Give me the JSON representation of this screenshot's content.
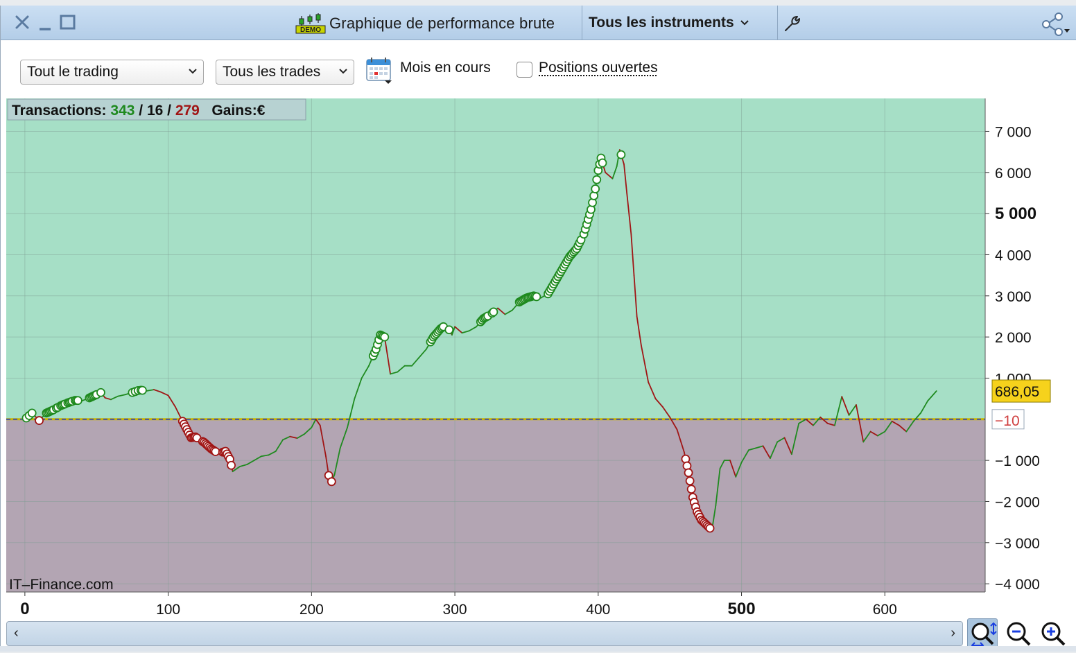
{
  "window": {
    "title": "Graphique de performance brute",
    "demo_badge": "DEMO",
    "instrument_selector": "Tous les instruments",
    "icons": [
      "close-icon",
      "minimize-icon",
      "maximize-icon",
      "demo-chart-icon",
      "wrench-icon",
      "share-icon"
    ]
  },
  "toolbar": {
    "trading_filter": "Tout le trading",
    "trades_filter": "Tous les trades",
    "period_label": "Mois en cours",
    "open_positions_label": "Positions ouvertes",
    "open_positions_checked": false
  },
  "stats": {
    "transactions_label": "Transactions:",
    "total": "343",
    "separator": "/",
    "neutral": "16",
    "losses": "279",
    "gains_label": "Gains:",
    "currency": "€"
  },
  "watermark": "IT–Finance.com",
  "colors": {
    "positive_zone": "#a6dfc6",
    "negative_zone": "#b3a5b3",
    "gain_line": "#1f8a1f",
    "loss_line": "#a01515",
    "current_badge": "#f6d21c",
    "title_bar": "#c1d6ec"
  },
  "chart_data": {
    "type": "line",
    "title": "",
    "xlabel": "",
    "ylabel": "",
    "x_ticks": [
      "0",
      "100",
      "200",
      "300",
      "400",
      "500",
      "600"
    ],
    "y_ticks": [
      "7 000",
      "6 000",
      "5 000",
      "4 000",
      "3 000",
      "2 000",
      "1 000",
      "−1 000",
      "−2 000",
      "−3 000",
      "−4 000"
    ],
    "xlim": [
      -13,
      670
    ],
    "ylim": [
      -4200,
      7800
    ],
    "baseline": 0,
    "current_value_label": "686,05",
    "reference_value_label": "−10",
    "grid": true,
    "series": [
      {
        "points": [
          [
            0,
            0
          ],
          [
            5,
            150
          ],
          [
            10,
            -30
          ],
          [
            15,
            150
          ],
          [
            20,
            230
          ],
          [
            25,
            330
          ],
          [
            30,
            400
          ],
          [
            35,
            460
          ],
          [
            40,
            450
          ],
          [
            45,
            520
          ],
          [
            50,
            600
          ],
          [
            53,
            650
          ],
          [
            56,
            520
          ],
          [
            60,
            480
          ],
          [
            65,
            560
          ],
          [
            70,
            600
          ],
          [
            75,
            650
          ],
          [
            80,
            710
          ],
          [
            85,
            690
          ],
          [
            90,
            720
          ],
          [
            95,
            660
          ],
          [
            100,
            580
          ],
          [
            105,
            300
          ],
          [
            110,
            -50
          ],
          [
            113,
            -250
          ],
          [
            116,
            -450
          ],
          [
            119,
            -430
          ],
          [
            122,
            -500
          ],
          [
            125,
            -560
          ],
          [
            130,
            -720
          ],
          [
            135,
            -830
          ],
          [
            140,
            -780
          ],
          [
            143,
            -970
          ],
          [
            145,
            -1270
          ],
          [
            150,
            -1150
          ],
          [
            155,
            -1100
          ],
          [
            160,
            -1000
          ],
          [
            165,
            -900
          ],
          [
            170,
            -870
          ],
          [
            175,
            -780
          ],
          [
            180,
            -500
          ],
          [
            185,
            -420
          ],
          [
            190,
            -460
          ],
          [
            195,
            -360
          ],
          [
            200,
            -200
          ],
          [
            203,
            0
          ],
          [
            206,
            -150
          ],
          [
            210,
            -900
          ],
          [
            213,
            -1600
          ],
          [
            216,
            -1350
          ],
          [
            220,
            -700
          ],
          [
            225,
            -200
          ],
          [
            230,
            500
          ],
          [
            235,
            1000
          ],
          [
            240,
            1300
          ],
          [
            245,
            1700
          ],
          [
            248,
            2050
          ],
          [
            251,
            2000
          ],
          [
            255,
            1100
          ],
          [
            260,
            1150
          ],
          [
            265,
            1300
          ],
          [
            270,
            1300
          ],
          [
            275,
            1500
          ],
          [
            280,
            1700
          ],
          [
            285,
            2000
          ],
          [
            290,
            2200
          ],
          [
            294,
            2300
          ],
          [
            298,
            2050
          ],
          [
            300,
            2250
          ],
          [
            305,
            2100
          ],
          [
            310,
            2150
          ],
          [
            315,
            2250
          ],
          [
            320,
            2450
          ],
          [
            325,
            2550
          ],
          [
            330,
            2700
          ],
          [
            335,
            2550
          ],
          [
            340,
            2650
          ],
          [
            345,
            2850
          ],
          [
            350,
            2950
          ],
          [
            355,
            3000
          ],
          [
            360,
            2950
          ],
          [
            365,
            3050
          ],
          [
            370,
            3350
          ],
          [
            375,
            3650
          ],
          [
            380,
            3950
          ],
          [
            385,
            4150
          ],
          [
            390,
            4500
          ],
          [
            395,
            5100
          ],
          [
            398,
            5600
          ],
          [
            400,
            6050
          ],
          [
            402,
            6350
          ],
          [
            405,
            6000
          ],
          [
            410,
            5850
          ],
          [
            413,
            6150
          ],
          [
            415,
            6550
          ],
          [
            418,
            6200
          ],
          [
            420,
            5500
          ],
          [
            423,
            4500
          ],
          [
            425,
            3500
          ],
          [
            427,
            2500
          ],
          [
            430,
            1800
          ],
          [
            435,
            900
          ],
          [
            440,
            500
          ],
          [
            445,
            300
          ],
          [
            450,
            50
          ],
          [
            455,
            -250
          ],
          [
            460,
            -800
          ],
          [
            463,
            -1300
          ],
          [
            466,
            -1900
          ],
          [
            469,
            -2250
          ],
          [
            472,
            -2450
          ],
          [
            475,
            -2550
          ],
          [
            478,
            -2650
          ],
          [
            480,
            -2550
          ],
          [
            482,
            -2100
          ],
          [
            485,
            -1200
          ],
          [
            488,
            -1000
          ],
          [
            492,
            -1000
          ],
          [
            496,
            -1400
          ],
          [
            500,
            -1050
          ],
          [
            505,
            -750
          ],
          [
            510,
            -700
          ],
          [
            515,
            -650
          ],
          [
            520,
            -950
          ],
          [
            525,
            -550
          ],
          [
            530,
            -450
          ],
          [
            535,
            -850
          ],
          [
            540,
            -100
          ],
          [
            545,
            0
          ],
          [
            550,
            -150
          ],
          [
            555,
            50
          ],
          [
            560,
            -100
          ],
          [
            565,
            -150
          ],
          [
            570,
            550
          ],
          [
            575,
            100
          ],
          [
            580,
            350
          ],
          [
            585,
            -550
          ],
          [
            590,
            -300
          ],
          [
            595,
            -400
          ],
          [
            600,
            -300
          ],
          [
            605,
            -50
          ],
          [
            610,
            -150
          ],
          [
            615,
            -300
          ],
          [
            620,
            -50
          ],
          [
            625,
            150
          ],
          [
            630,
            450
          ],
          [
            636,
            686
          ]
        ],
        "gain_markers_x": [
          1,
          3,
          5,
          15,
          16,
          17,
          18,
          19,
          20,
          22,
          23,
          25,
          26,
          27,
          28,
          30,
          31,
          32,
          33,
          35,
          36,
          37,
          45,
          46,
          47,
          48,
          49,
          50,
          53,
          75,
          77,
          79,
          81,
          82,
          243,
          244,
          245,
          246,
          247,
          248,
          249,
          250,
          251,
          283,
          284,
          285,
          286,
          287,
          288,
          289,
          290,
          291,
          292,
          296,
          318,
          319,
          320,
          321,
          322,
          323,
          326,
          327,
          345,
          346,
          347,
          348,
          349,
          350,
          351,
          352,
          353,
          354,
          355,
          356,
          357,
          365,
          366,
          367,
          368,
          369,
          370,
          371,
          372,
          373,
          374,
          375,
          376,
          377,
          378,
          379,
          380,
          381,
          382,
          383,
          384,
          385,
          386,
          387,
          388,
          390,
          391,
          392,
          393,
          394,
          395,
          396,
          397,
          398,
          399,
          400,
          401,
          402,
          403,
          416
        ],
        "loss_markers_x": [
          10,
          110,
          111,
          112,
          113,
          114,
          115,
          116,
          117,
          118,
          119,
          120,
          124,
          125,
          126,
          127,
          128,
          129,
          130,
          131,
          132,
          133,
          138,
          139,
          140,
          141,
          142,
          143,
          144,
          212,
          214,
          461,
          462,
          463,
          464,
          465,
          466,
          467,
          468,
          469,
          470,
          471,
          472,
          473,
          474,
          475,
          476,
          477,
          478
        ]
      }
    ]
  }
}
